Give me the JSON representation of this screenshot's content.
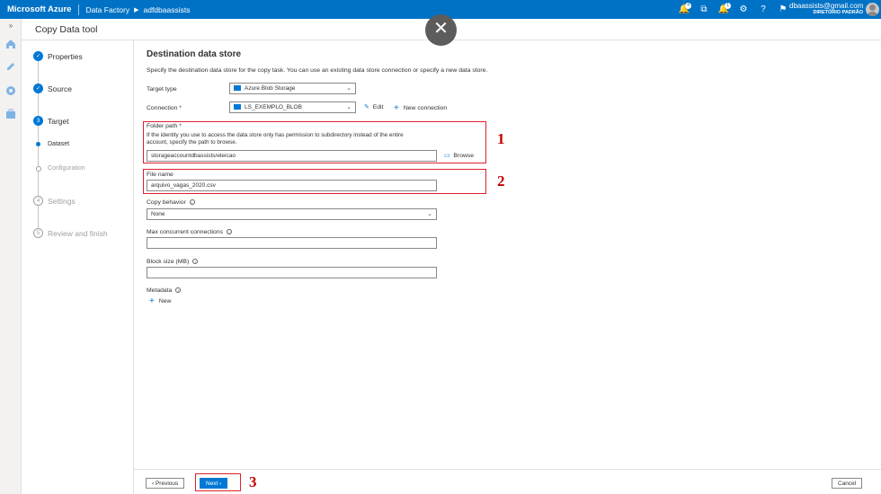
{
  "topbar": {
    "brand": "Microsoft Azure",
    "breadcrumb": [
      "Data Factory",
      "adfdbaassists"
    ],
    "notifications_badge": "4",
    "alerts_badge": "1",
    "user_email": "dbaassists@gmail.com",
    "user_directory": "DIRETÓRIO PADRÃO"
  },
  "titlebar": {
    "title": "Copy Data tool"
  },
  "steps": [
    {
      "label": "Properties",
      "state": "done",
      "marker": "✓"
    },
    {
      "label": "Source",
      "state": "done",
      "marker": "✓"
    },
    {
      "label": "Target",
      "state": "current",
      "marker": "3"
    },
    {
      "label": "Dataset",
      "state": "sub-current",
      "marker": ""
    },
    {
      "label": "Configuration",
      "state": "sub-pending",
      "marker": ""
    },
    {
      "label": "Settings",
      "state": "pending",
      "marker": "4"
    },
    {
      "label": "Review and finish",
      "state": "pending",
      "marker": "5"
    }
  ],
  "form": {
    "heading": "Destination data store",
    "description": "Specify the destination data store for the copy task. You can use an existing data store connection or specify a new data store.",
    "target_type": {
      "label": "Target type",
      "value": "Azure Blob Storage"
    },
    "connection": {
      "label": "Connection *",
      "value": "LS_EXEMPLO_BLOB",
      "edit_label": "Edit",
      "new_label": "New connection"
    },
    "folder_path": {
      "label": "Folder path *",
      "help": "If the identity you use to access the data store only has permission to subdirectory instead of the entire account, specify the path to browse.",
      "help_line1": "If the identity you use to access the data store only has permission to subdirectory instead of the entire",
      "help_line2": "account, specify the path to browse.",
      "value": "storageaccountdbassists/eleicao",
      "browse_label": "Browse"
    },
    "file_name": {
      "label": "File name",
      "value": "arquivo_vagas_2020.csv"
    },
    "copy_behavior": {
      "label": "Copy behavior",
      "value": "None"
    },
    "max_connections": {
      "label": "Max concurrent connections",
      "value": ""
    },
    "block_size": {
      "label": "Block size (MB)",
      "value": ""
    },
    "metadata": {
      "label": "Metadata",
      "new_label": "New"
    }
  },
  "annotations": [
    "1",
    "2",
    "3"
  ],
  "footer": {
    "previous_label": "‹ Previous",
    "next_label": "Next ›",
    "cancel_label": "Cancel"
  },
  "colors": {
    "accent": "#0078d4",
    "topbar": "#0072c6",
    "annotation_red": "#c40000"
  }
}
